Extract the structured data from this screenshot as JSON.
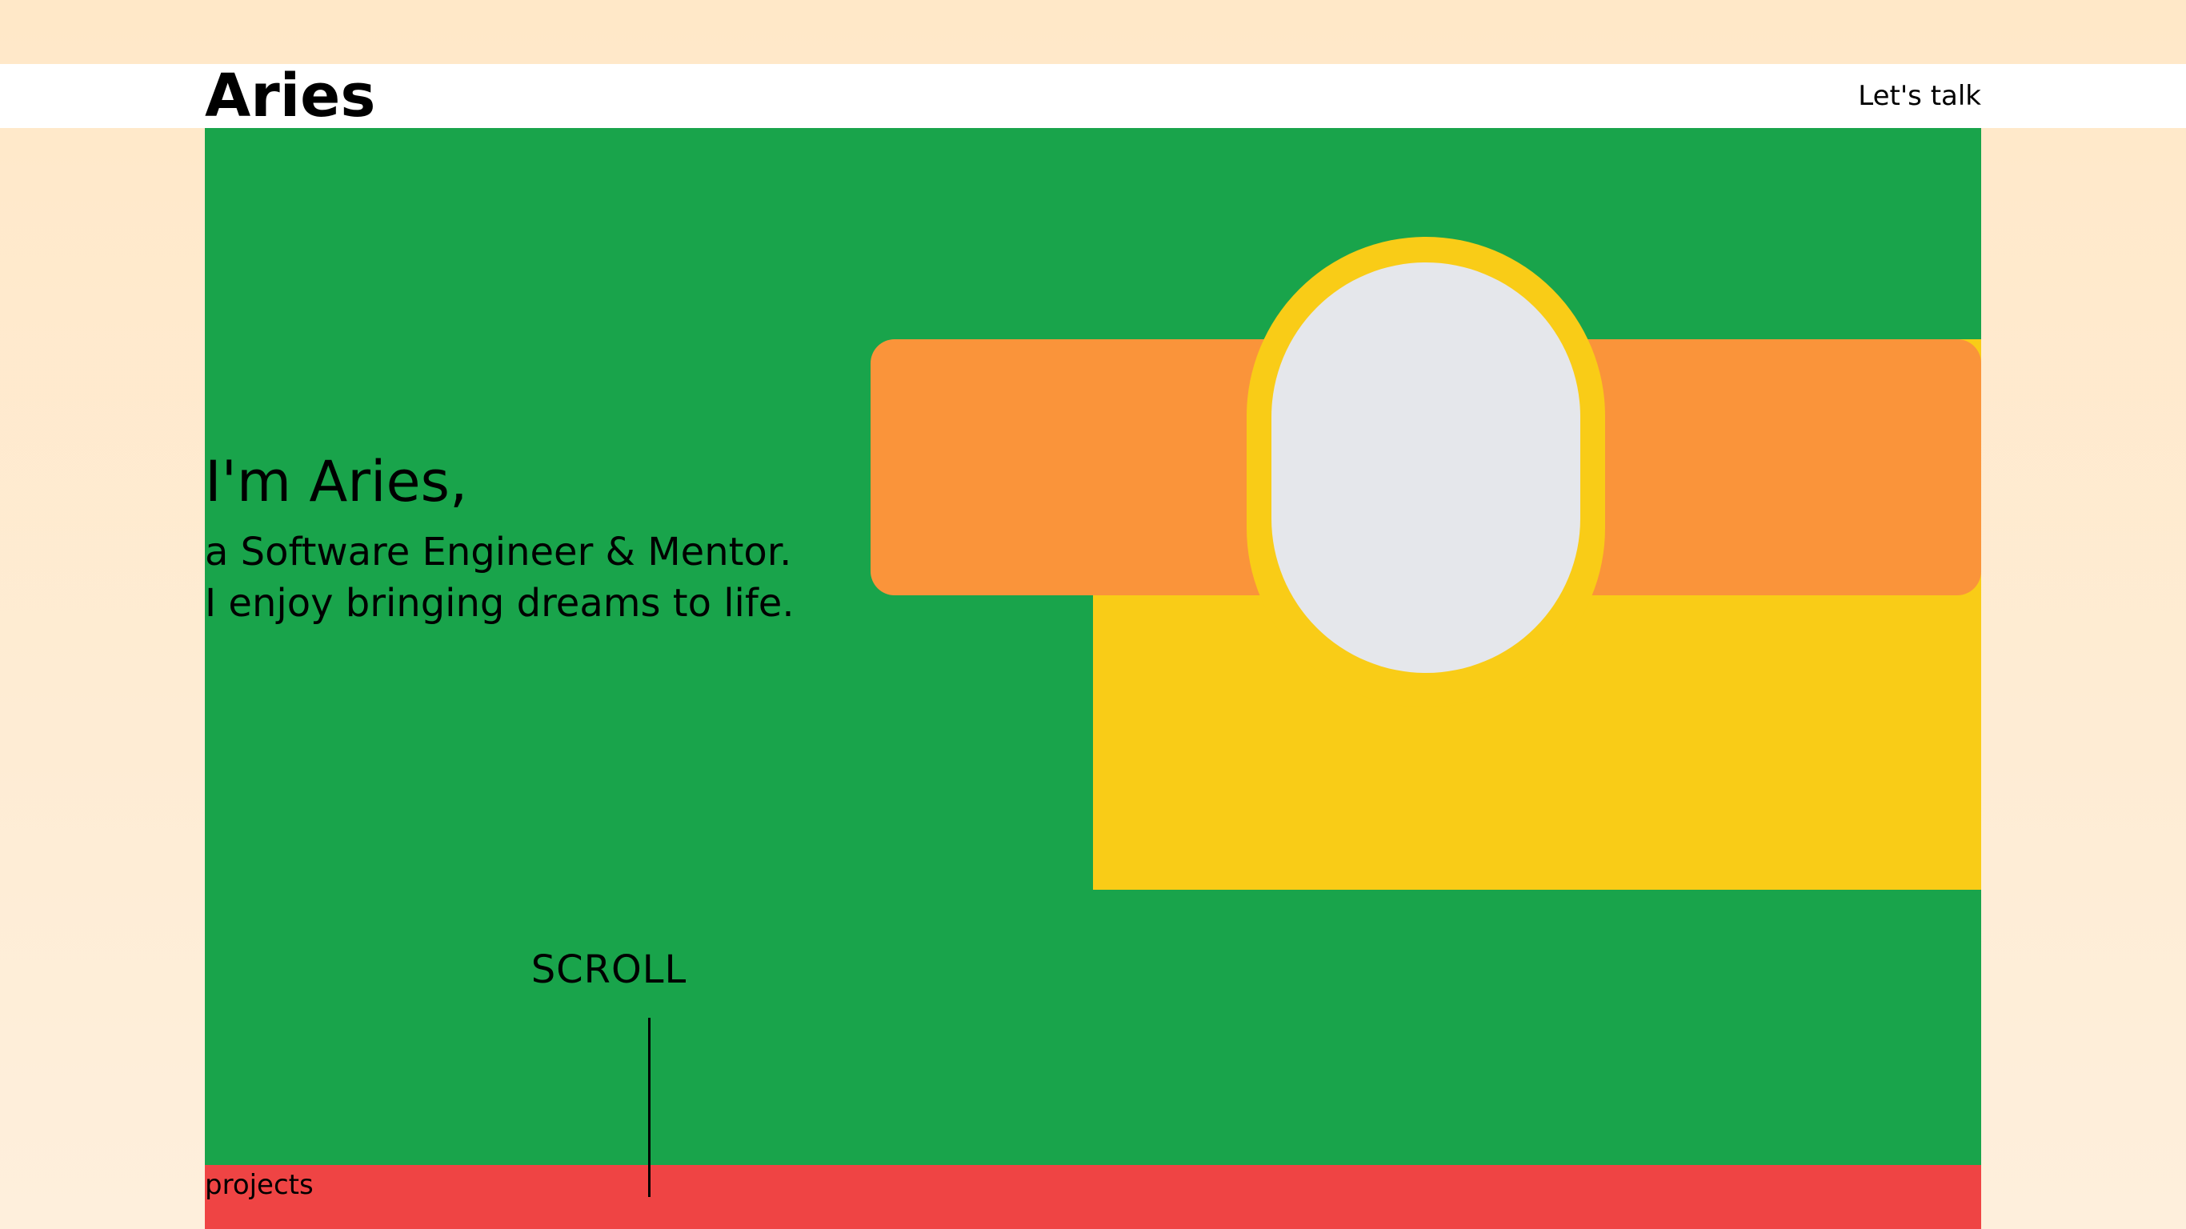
{
  "header": {
    "brand": "Aries",
    "cta_label": "Let's talk"
  },
  "hero": {
    "greeting": "I'm Aries,",
    "tagline_line1": "a Software Engineer & Mentor.",
    "tagline_line2": "I enjoy bringing dreams to life.",
    "scroll_label": "SCROLL"
  },
  "sections": {
    "projects_label": "projects"
  },
  "colors": {
    "page_background": "#FFE8C8",
    "header_background": "#FFFFFF",
    "hero_green": "#19A44B",
    "accent_orange": "#FA943A",
    "accent_yellow": "#F9CC17",
    "avatar_placeholder": "#E5E7EB",
    "projects_red": "#EF4444",
    "text": "#000000"
  }
}
